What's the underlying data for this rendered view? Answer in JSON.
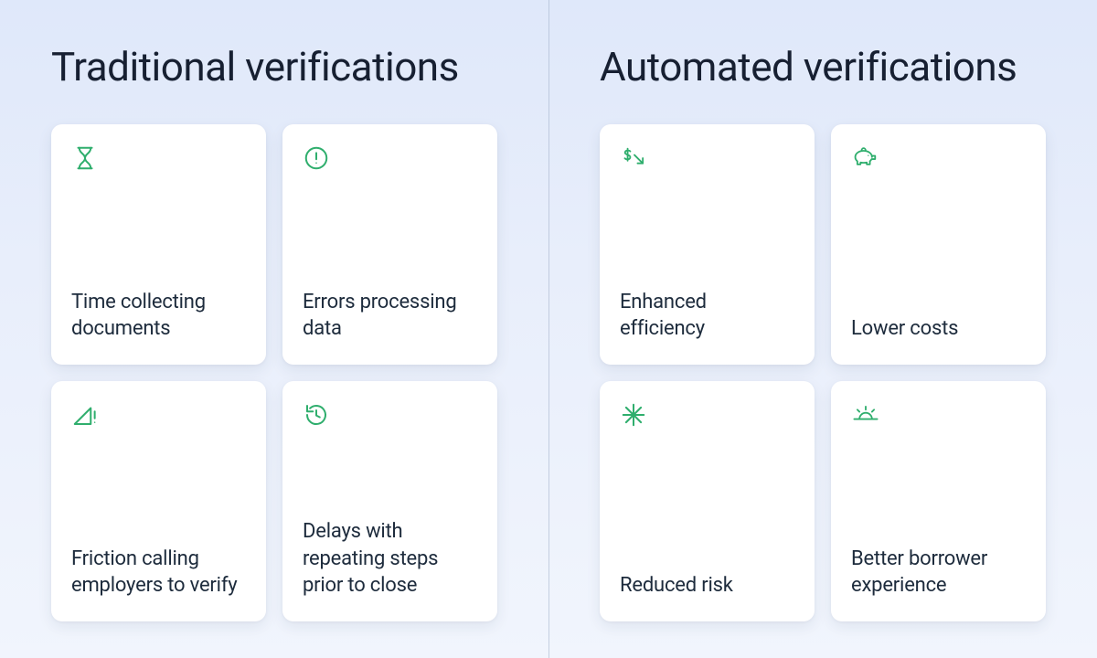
{
  "columns": {
    "left": {
      "title": "Traditional verifications",
      "cards": [
        {
          "icon": "hourglass-icon",
          "label": "Time collecting documents"
        },
        {
          "icon": "alert-circle-icon",
          "label": "Errors processing data"
        },
        {
          "icon": "no-signal-icon",
          "label": "Friction calling employers to verify"
        },
        {
          "icon": "clock-back-icon",
          "label": "Delays with repeating steps prior to close"
        }
      ]
    },
    "right": {
      "title": "Automated verifications",
      "cards": [
        {
          "icon": "dollar-arrow-icon",
          "label": "Enhanced efficiency"
        },
        {
          "icon": "piggy-bank-icon",
          "label": "Lower costs"
        },
        {
          "icon": "asterisk-icon",
          "label": "Reduced risk"
        },
        {
          "icon": "sunrise-icon",
          "label": "Better borrower experience"
        }
      ]
    }
  },
  "colors": {
    "icon": "#2fae6d",
    "text": "#1d2b3c",
    "background_top": "#dfe8fa",
    "background_bottom": "#f1f5fd"
  }
}
